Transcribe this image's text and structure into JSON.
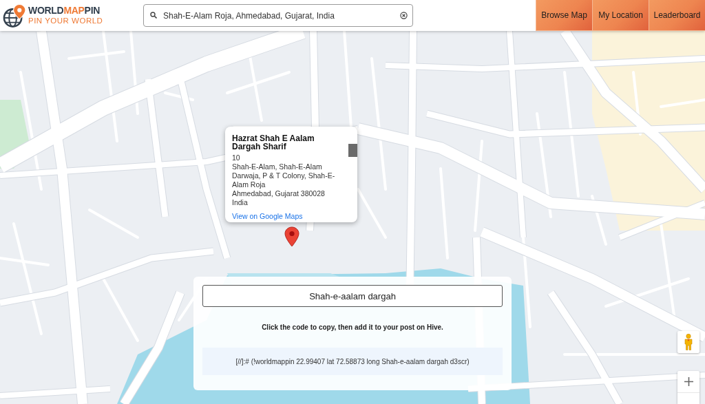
{
  "header": {
    "logo": {
      "wordmark": [
        {
          "text": "WORLD",
          "accent": false
        },
        {
          "text": "MAP",
          "accent": true
        },
        {
          "text": "PIN",
          "accent": false
        }
      ],
      "tagline": "PIN YOUR WORLD"
    },
    "search": {
      "value": "Shah-E-Alam Roja, Ahmedabad, Gujarat, India"
    },
    "nav_buttons": [
      "Browse Map",
      "My Location",
      "Leaderboard"
    ]
  },
  "map": {
    "info_window": {
      "title": "Hazrat Shah E Aalam Dargah Sharif",
      "address_lines": [
        "10",
        "Shah-E-Alam, Shah-E-Alam Darwaja, P & T Colony, Shah-E-Alam Roja",
        "Ahmedabad, Gujarat 380028",
        "India"
      ],
      "link": "View on Google Maps"
    }
  },
  "pin_panel": {
    "name_value": "Shah-e-aalam dargah",
    "instruction": "Click the code to copy, then add it to your post on Hive.",
    "code": "[//]:# (!worldmappin 22.99407 lat 72.58873 long Shah-e-aalam dargah d3scr)"
  }
}
